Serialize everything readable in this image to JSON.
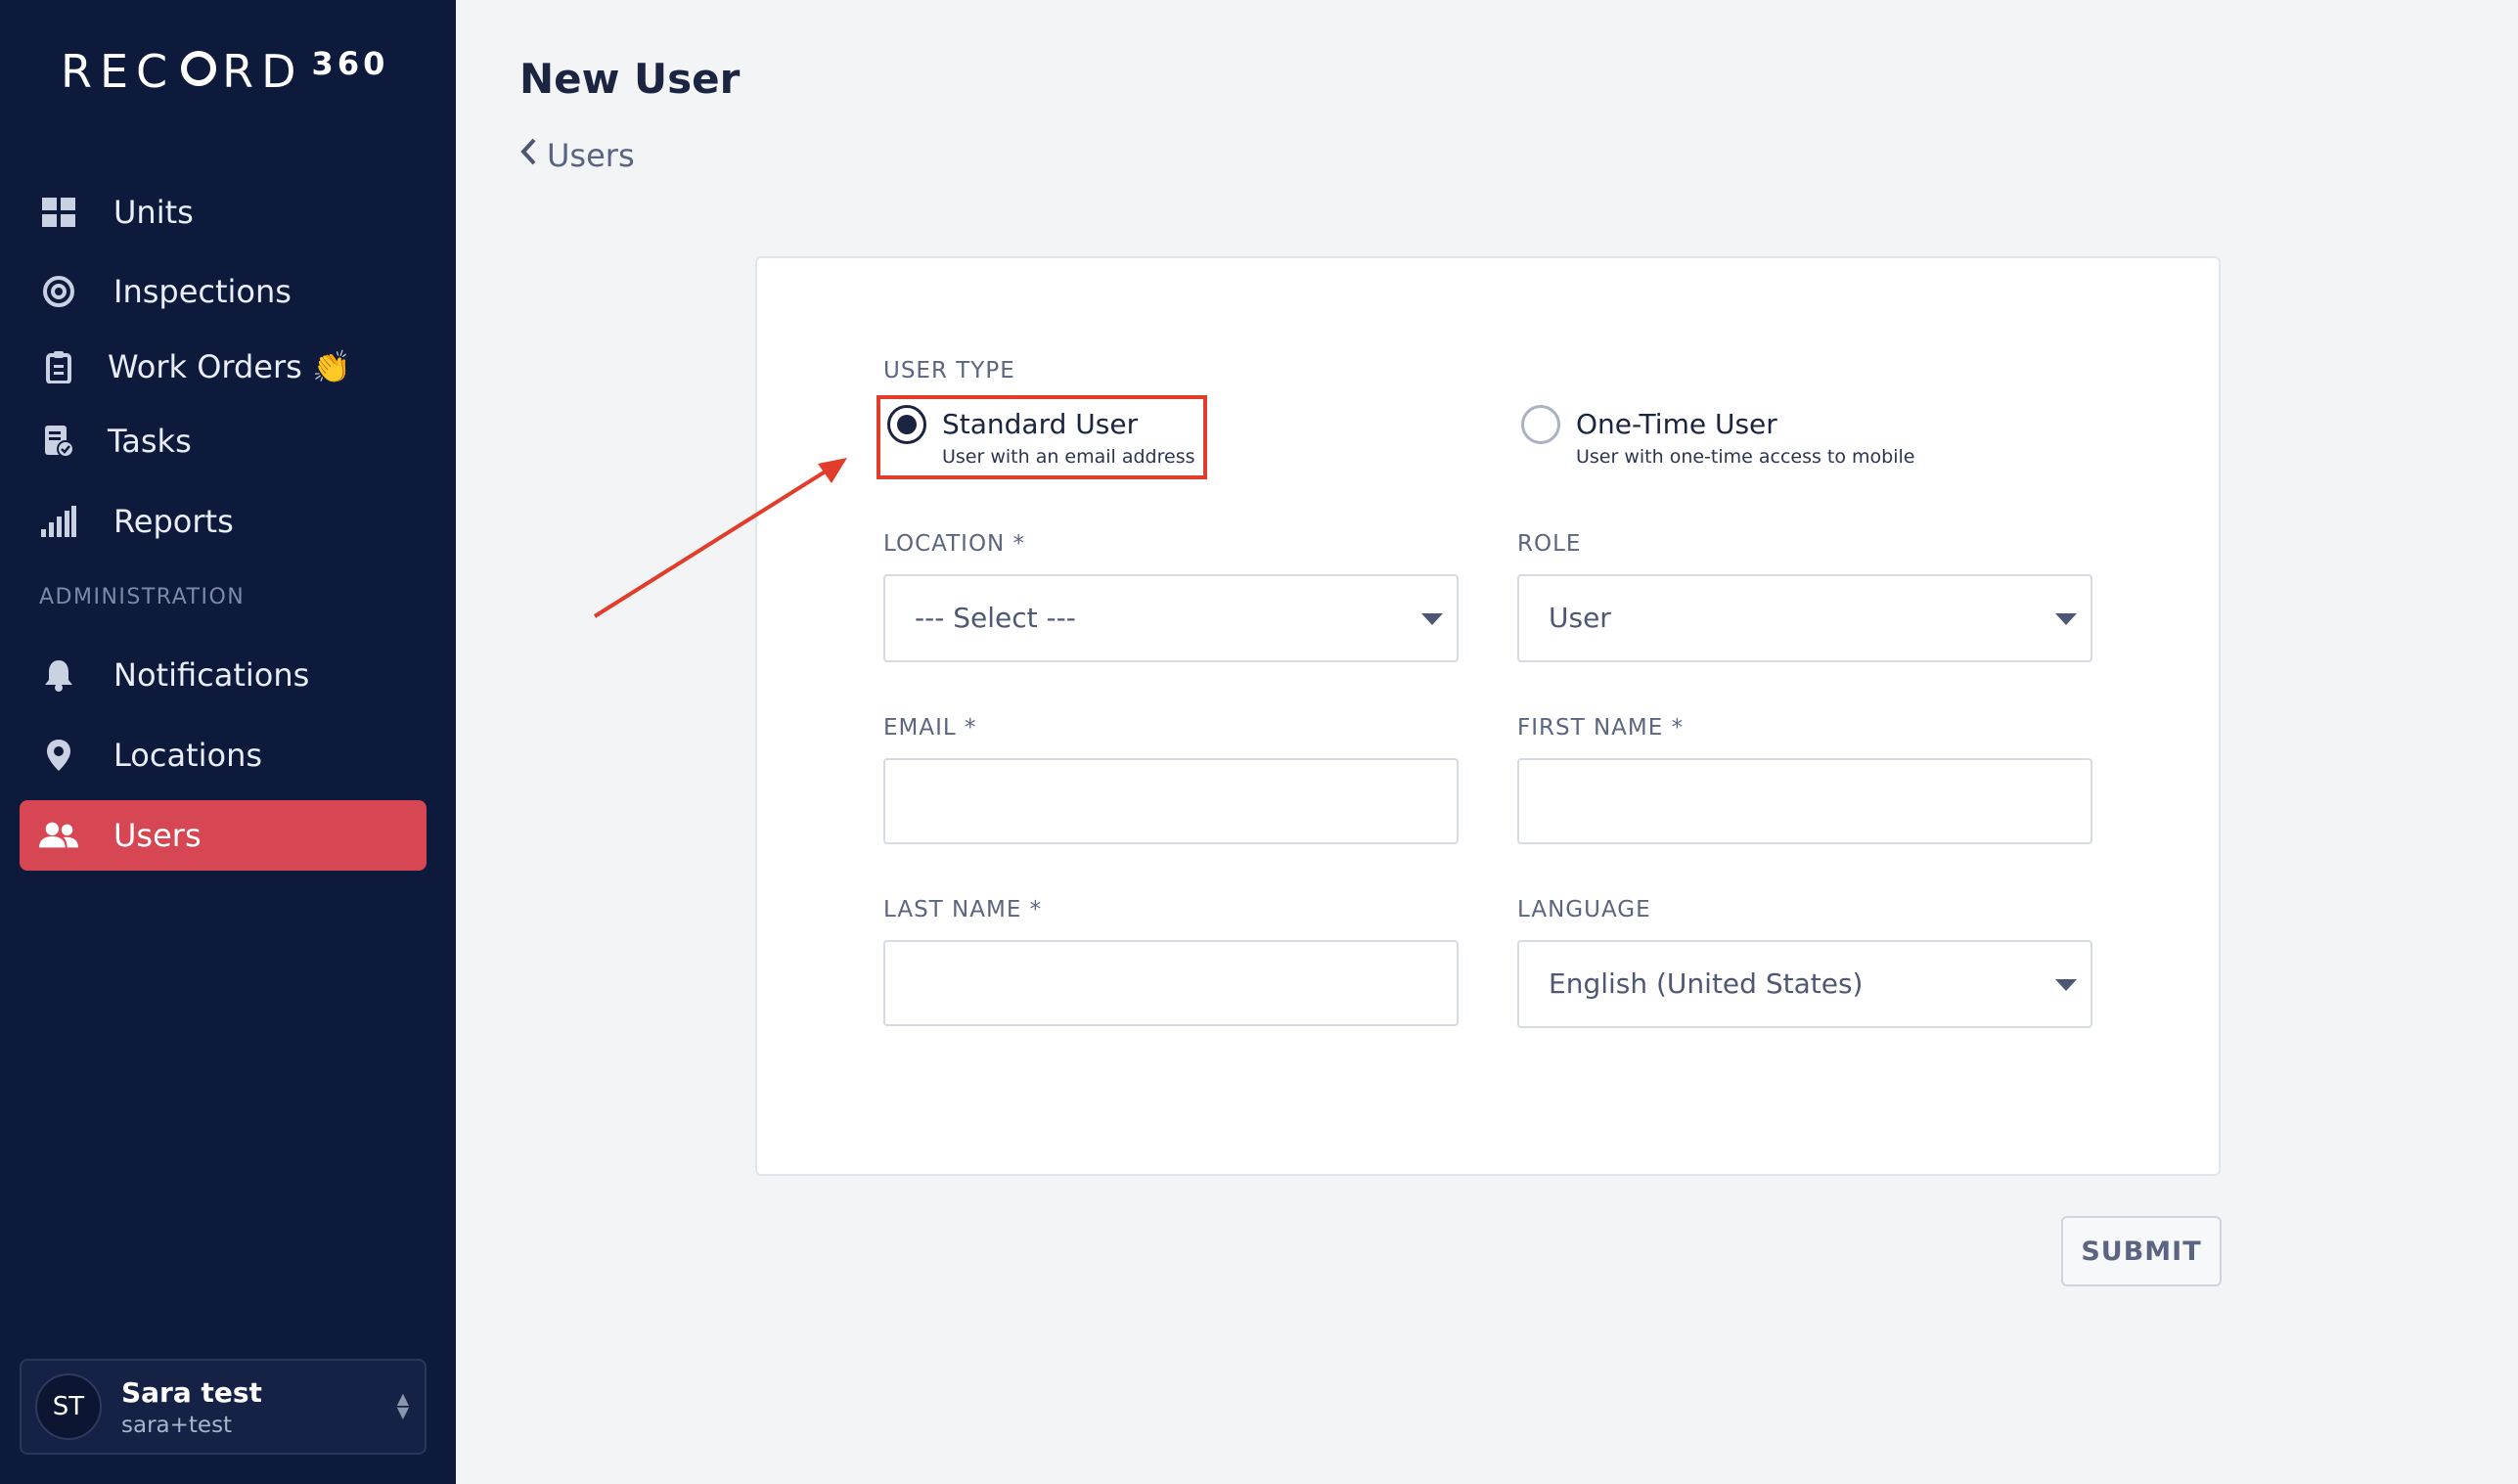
{
  "app": {
    "logo_text": "REC",
    "logo_text_end": "RD",
    "logo_number": "360"
  },
  "sidebar": {
    "items": [
      {
        "label": "Units",
        "icon": "grid-icon"
      },
      {
        "label": "Inspections",
        "icon": "target-icon"
      },
      {
        "label": "Work Orders 👏",
        "icon": "clipboard-icon"
      },
      {
        "label": "Tasks",
        "icon": "task-list-icon"
      },
      {
        "label": "Reports",
        "icon": "bar-chart-icon"
      }
    ],
    "section_label": "ADMINISTRATION",
    "admin_items": [
      {
        "label": "Notifications",
        "icon": "bell-icon"
      },
      {
        "label": "Locations",
        "icon": "map-pin-icon"
      },
      {
        "label": "Users",
        "icon": "users-icon",
        "active": true
      }
    ],
    "user": {
      "initials": "ST",
      "name": "Sara test",
      "email": "sara+test"
    }
  },
  "header": {
    "title": "New User",
    "back_label": "Users"
  },
  "form": {
    "user_type_label": "USER TYPE",
    "user_types": [
      {
        "title": "Standard User",
        "description": "User with an email address",
        "selected": true
      },
      {
        "title": "One-Time User",
        "description": "User with one-time access to mobile",
        "selected": false
      }
    ],
    "location": {
      "label": "LOCATION *",
      "value": "--- Select ---"
    },
    "role": {
      "label": "ROLE",
      "value": "User"
    },
    "email": {
      "label": "EMAIL *",
      "value": ""
    },
    "first_name": {
      "label": "FIRST NAME *",
      "value": ""
    },
    "last_name": {
      "label": "LAST NAME *",
      "value": ""
    },
    "language": {
      "label": "LANGUAGE",
      "value": "English (United States)"
    },
    "submit_label": "SUBMIT"
  },
  "colors": {
    "sidebar_bg": "#0e1a3b",
    "active_item": "#d64653",
    "highlight_annotation": "#e23c2a"
  }
}
